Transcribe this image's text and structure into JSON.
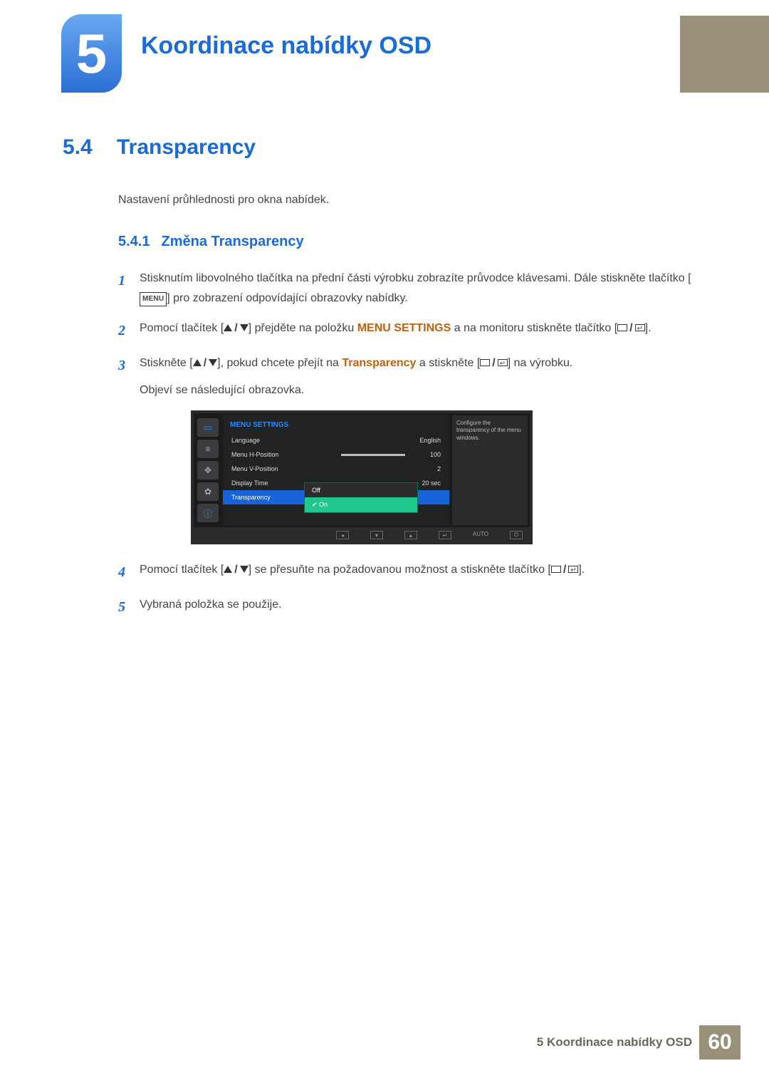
{
  "chapter": {
    "number": "5",
    "title": "Koordinace nabídky OSD"
  },
  "section": {
    "number": "5.4",
    "title": "Transparency",
    "intro": "Nastavení průhlednosti pro okna nabídek."
  },
  "subsection": {
    "number": "5.4.1",
    "title": "Změna Transparency"
  },
  "steps": {
    "s1": {
      "num": "1",
      "text_a": "Stisknutím libovolného tlačítka na přední části výrobku zobrazíte průvodce klávesami. Dále stiskněte tlačítko [",
      "text_b": "] pro zobrazení odpovídající obrazovky nabídky.",
      "menu_key": "MENU"
    },
    "s2": {
      "num": "2",
      "text_a": "Pomocí tlačítek [",
      "text_b": "] přejděte na položku ",
      "hl": "MENU SETTINGS",
      "text_c": " a na monitoru stiskněte tlačítko [",
      "text_d": "]."
    },
    "s3": {
      "num": "3",
      "text_a": "Stiskněte [",
      "text_b": "], pokud chcete přejít na ",
      "hl": "Transparency",
      "text_c": " a stiskněte [",
      "text_d": "] na výrobku.",
      "text_e": "Objeví se následující obrazovka."
    },
    "s4": {
      "num": "4",
      "text_a": "Pomocí tlačítek [",
      "text_b": "] se přesuňte na požadovanou možnost a stiskněte tlačítko [",
      "text_c": "]."
    },
    "s5": {
      "num": "5",
      "text": "Vybraná položka se použije."
    }
  },
  "osd": {
    "header": "MENU SETTINGS",
    "rows": {
      "language": {
        "label": "Language",
        "value": "English"
      },
      "hpos": {
        "label": "Menu H-Position",
        "value": "100"
      },
      "vpos": {
        "label": "Menu V-Position",
        "value": "2"
      },
      "dtime": {
        "label": "Display Time",
        "value": "20 sec"
      },
      "trans": {
        "label": "Transparency"
      }
    },
    "dropdown": {
      "off": "Off",
      "on": "On"
    },
    "tooltip": "Configure the transparency of the menu windows.",
    "controls": {
      "auto": "AUTO"
    }
  },
  "footer": {
    "text": "5 Koordinace nabídky OSD",
    "page": "60"
  }
}
